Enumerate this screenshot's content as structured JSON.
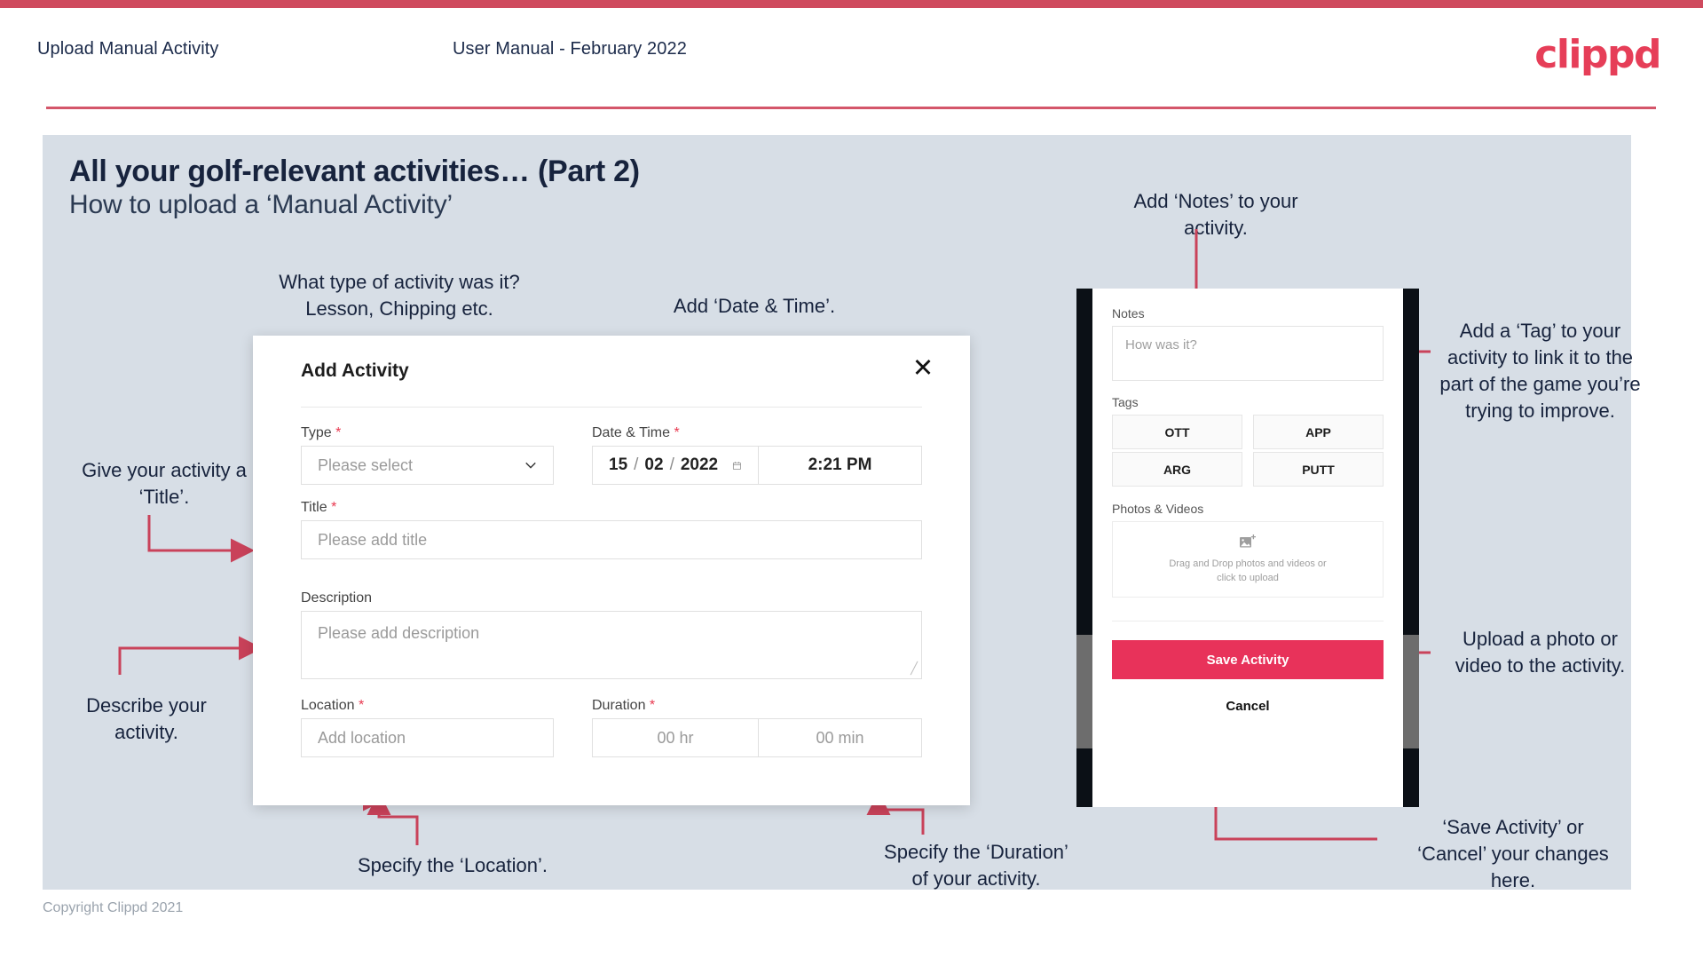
{
  "header": {
    "left_title": "Upload Manual Activity",
    "center_title": "User Manual - February 2022",
    "logo": "clippd"
  },
  "slide": {
    "title": "All your golf-relevant activities… (Part 2)",
    "subtitle": "How to upload a ‘Manual Activity’"
  },
  "annotations": {
    "type": "What type of activity was it?\nLesson, Chipping etc.",
    "datetime": "Add ‘Date & Time’.",
    "title": "Give your activity a\n‘Title’.",
    "description": "Describe your\nactivity.",
    "location": "Specify the ‘Location’.",
    "duration": "Specify the ‘Duration’\nof your activity.",
    "notes": "Add ‘Notes’ to your\nactivity.",
    "tags": "Add a ‘Tag’ to your activity to link it to the part of the game you’re trying to improve.",
    "photos": "Upload a photo or\nvideo to the activity.",
    "save": "‘Save Activity’ or\n‘Cancel’ your changes\nhere."
  },
  "dialog": {
    "title": "Add Activity",
    "close_icon": "close-icon",
    "fields": {
      "type": {
        "label": "Type",
        "required": true,
        "placeholder": "Please select"
      },
      "datetime": {
        "label": "Date & Time",
        "required": true,
        "day": "15",
        "month": "02",
        "year": "2022",
        "sep": "/",
        "time": "2:21 PM",
        "calendar_icon": "calendar-icon"
      },
      "title": {
        "label": "Title",
        "required": true,
        "placeholder": "Please add title"
      },
      "description": {
        "label": "Description",
        "required": false,
        "placeholder": "Please add description"
      },
      "location": {
        "label": "Location",
        "required": true,
        "placeholder": "Add location"
      },
      "duration": {
        "label": "Duration",
        "required": true,
        "hours": "00 hr",
        "minutes": "00 min"
      }
    }
  },
  "phone": {
    "notes": {
      "label": "Notes",
      "placeholder": "How was it?"
    },
    "tags": {
      "label": "Tags",
      "options": [
        "OTT",
        "APP",
        "ARG",
        "PUTT"
      ]
    },
    "photos": {
      "label": "Photos & Videos",
      "icon": "add-image-icon",
      "dropzone_line1": "Drag and Drop photos and videos or",
      "dropzone_line2": "click to upload"
    },
    "save_label": "Save Activity",
    "cancel_label": "Cancel"
  },
  "footer": {
    "copyright": "Copyright Clippd 2021"
  },
  "colors": {
    "brand_pink": "#e8325a",
    "accent_rule": "#cf4a5e",
    "arrow": "#c9425a",
    "slide_bg": "#d7dee6",
    "heading": "#17233d"
  }
}
